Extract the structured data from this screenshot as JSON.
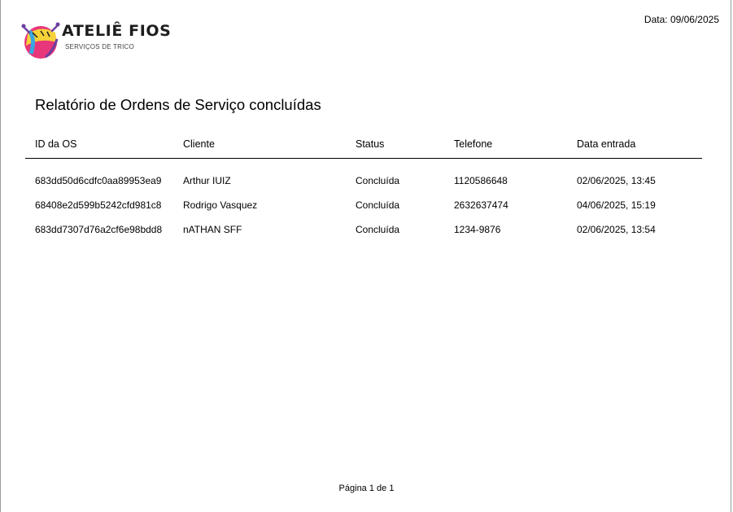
{
  "header": {
    "logo_title": "ATELIÊ FIOS",
    "logo_subtitle": "SERVIÇOS DE TRICO",
    "date_label": "Data: 09/06/2025"
  },
  "report": {
    "title": "Relatório de Ordens de Serviço concluídas",
    "columns": [
      "ID da OS",
      "Cliente",
      "Status",
      "Telefone",
      "Data entrada"
    ],
    "rows": [
      {
        "id": "683dd50d6cdfc0aa89953ea9",
        "client": "Arthur IUIZ",
        "status": "Concluída",
        "phone": "1120586648",
        "date": "02/06/2025, 13:45"
      },
      {
        "id": "68408e2d599b5242cfd981c8",
        "client": "Rodrigo Vasquez",
        "status": "Concluída",
        "phone": "2632637474",
        "date": "04/06/2025, 15:19"
      },
      {
        "id": "683dd7307d76a2cf6e98bdd8",
        "client": "nATHAN SFF",
        "status": "Concluída",
        "phone": "1234-9876",
        "date": "02/06/2025, 13:54"
      }
    ]
  },
  "footer": {
    "pagination": "Página 1 de 1"
  },
  "colors": {
    "logo_pink": "#e8367a",
    "logo_yellow": "#f6d23a",
    "logo_blue": "#3aa7e0",
    "logo_purple": "#6a3fa0"
  }
}
